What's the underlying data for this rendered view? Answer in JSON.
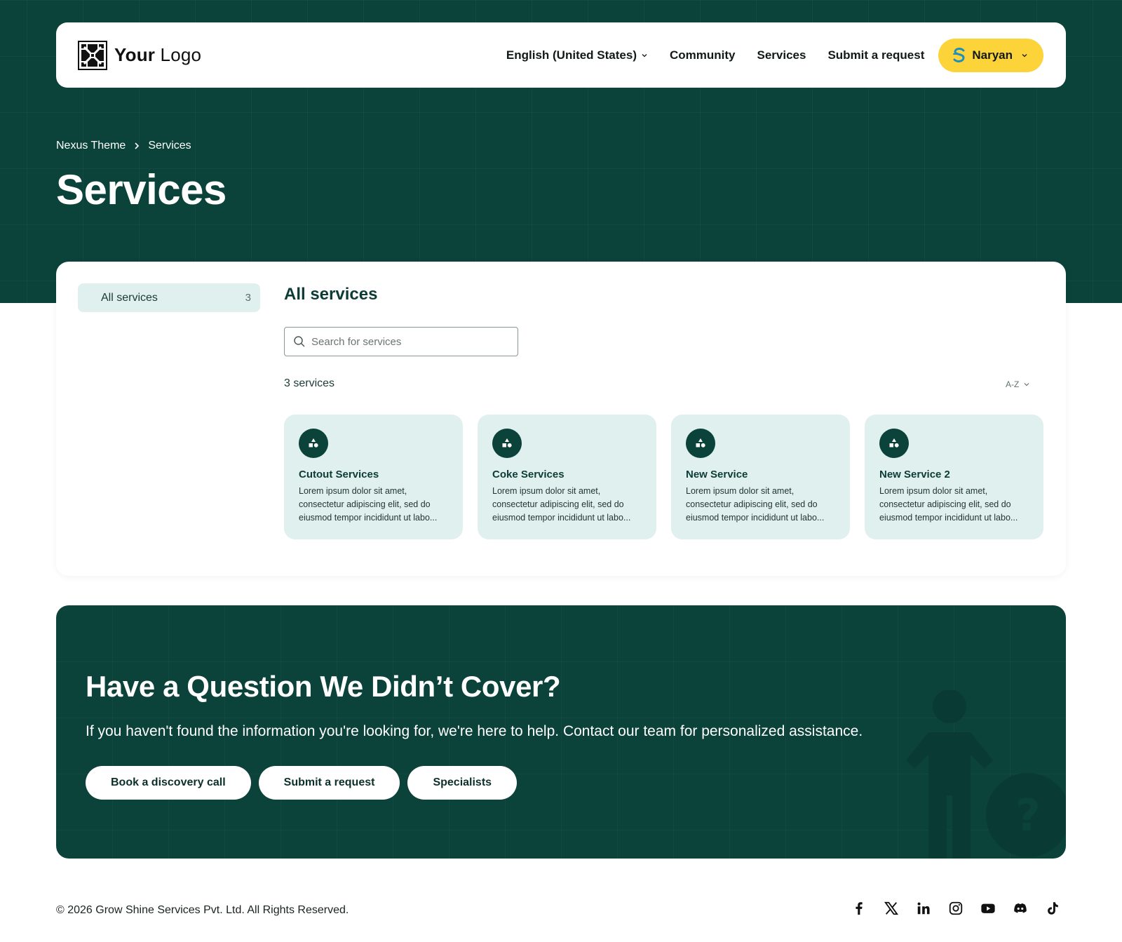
{
  "header": {
    "logo_bold": "Your",
    "logo_rest": "Logo",
    "nav": {
      "language": "English (United States)",
      "community": "Community",
      "services": "Services",
      "submit_request": "Submit a request"
    },
    "user_name": "Naryan"
  },
  "breadcrumb": {
    "home": "Nexus Theme",
    "current": "Services"
  },
  "page_title": "Services",
  "sidebar": {
    "items": [
      {
        "label": "All services",
        "count": "3"
      }
    ]
  },
  "main": {
    "section_title": "All services",
    "search_placeholder": "Search for services",
    "result_count": "3 services",
    "sort_label": "A-Z",
    "cards": [
      {
        "title": "Cutout Services",
        "description": "Lorem ipsum dolor sit amet, consectetur adipiscing elit, sed do eiusmod tempor incididunt ut labo..."
      },
      {
        "title": "Coke Services",
        "description": "Lorem ipsum dolor sit amet, consectetur adipiscing elit, sed do eiusmod tempor incididunt ut labo..."
      },
      {
        "title": "New Service",
        "description": "Lorem ipsum dolor sit amet, consectetur adipiscing elit, sed do eiusmod tempor incididunt ut labo..."
      },
      {
        "title": "New Service 2",
        "description": "Lorem ipsum dolor sit amet, consectetur adipiscing elit, sed do eiusmod tempor incididunt ut labo..."
      }
    ]
  },
  "cta": {
    "title": "Have a Question We Didn’t Cover?",
    "text": "If you haven't found the information you're looking for, we're here to help. Contact our team for personalized assistance.",
    "buttons": [
      "Book a discovery call",
      "Submit a request",
      "Specialists"
    ]
  },
  "footer": {
    "copyright": "© 2026 Grow Shine Services Pvt. Ltd. All Rights Reserved.",
    "socials": [
      "facebook-icon",
      "x-icon",
      "linkedin-icon",
      "instagram-icon",
      "youtube-icon",
      "discord-icon",
      "tiktok-icon"
    ]
  },
  "colors": {
    "brand_dark": "#0b423a",
    "accent_yellow": "#fdd33a",
    "card_bg": "#dff0ee"
  }
}
